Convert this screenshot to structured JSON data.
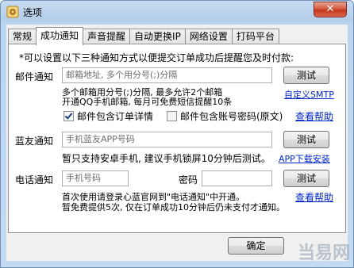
{
  "window": {
    "title": "选项",
    "close_glyph": "✕"
  },
  "tabs": [
    {
      "label": "常规"
    },
    {
      "label": "成功通知"
    },
    {
      "label": "声音提醒"
    },
    {
      "label": "自动更换IP"
    },
    {
      "label": "网络设置"
    },
    {
      "label": "打码平台"
    }
  ],
  "notice": "*可以设置以下三种通知方式以便提交订单成功后提醒您及时付款:",
  "email": {
    "label": "邮件通知",
    "placeholder": "邮箱地址, 多个用分号(;)分隔",
    "test_button": "测试",
    "hint_line1": "多个邮箱用分号(;)分隔, 最多允许2个邮箱",
    "hint_line2": "开通QQ手机邮箱, 每月可免费短信提醒10条",
    "custom_smtp_link": "自定义SMTP",
    "checkbox_details": "邮件包含订单详情",
    "checkbox_details_checked": true,
    "checkbox_password": "邮件包含账号密码(原文)",
    "checkbox_password_checked": false,
    "help_link": "查看帮助"
  },
  "bluefriend": {
    "label": "蓝友通知",
    "placeholder": "手机蓝友APP号码",
    "test_button": "测试",
    "hint": "暂只支持安卓手机, 建议手机锁屏10分钟后测试。",
    "download_link": "APP下载安装"
  },
  "phone": {
    "label": "电话通知",
    "phone_placeholder": "手机号码",
    "password_label": "密码",
    "test_button": "测试",
    "hint_line1": "首次使用请登录心蓝官网到\"电话通知\"中开通。",
    "help_link": "查看帮助",
    "hint_line2": "暂免费提供5次, 仅在订单成功10分钟后仍未支付才通知。"
  },
  "footer": {
    "ok_button": "确定",
    "watermark": "当易网"
  },
  "colors": {
    "title_bar": "#b9d1ea",
    "link": "#0026c9",
    "close_button": "#c5371c"
  }
}
